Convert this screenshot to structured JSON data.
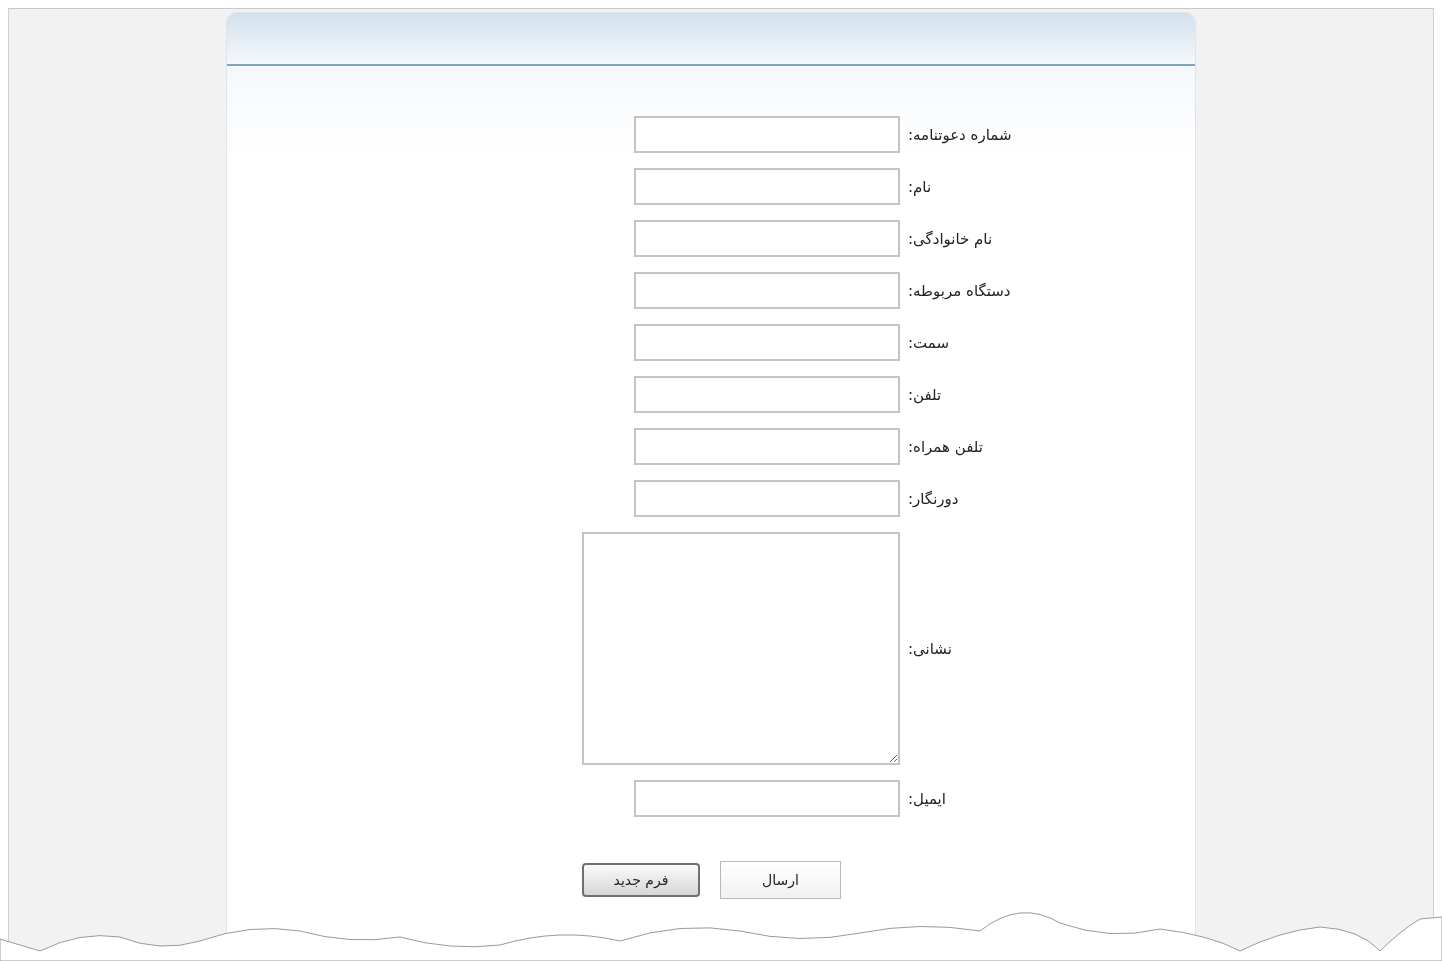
{
  "form": {
    "fields": [
      {
        "label": "شماره دعوتنامه:",
        "kind": "text"
      },
      {
        "label": "نام:",
        "kind": "text"
      },
      {
        "label": "نام خانوادگی:",
        "kind": "text"
      },
      {
        "label": "دستگاه مربوطه:",
        "kind": "text"
      },
      {
        "label": "سمت:",
        "kind": "text"
      },
      {
        "label": "تلفن:",
        "kind": "text"
      },
      {
        "label": "تلفن همراه:",
        "kind": "text"
      },
      {
        "label": "دورنگار:",
        "kind": "text"
      },
      {
        "label": "نشانی:",
        "kind": "textarea"
      },
      {
        "label": "ایمیل:",
        "kind": "text"
      }
    ]
  },
  "buttons": [
    {
      "label": "ارسال",
      "kind": "primary"
    },
    {
      "label": "فرم جدید",
      "kind": "secondary"
    }
  ]
}
